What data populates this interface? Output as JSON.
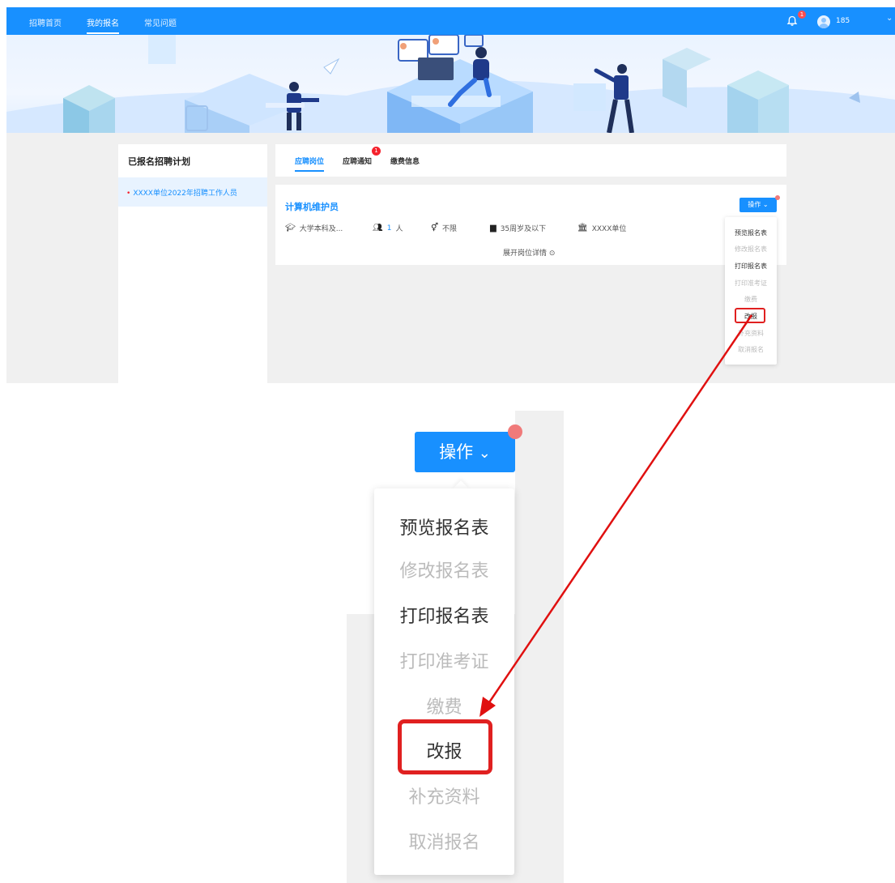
{
  "nav": {
    "items": [
      {
        "label": "招聘首页"
      },
      {
        "label": "我的报名"
      },
      {
        "label": "常见问题"
      }
    ],
    "notification_count": "1",
    "user_name": "185"
  },
  "sidebar": {
    "title": "已报名招聘计划",
    "items": [
      {
        "label": "XXXX单位2022年招聘工作人员"
      }
    ]
  },
  "tabs": [
    {
      "label": "应聘岗位"
    },
    {
      "label": "应聘通知"
    },
    {
      "label": "缴费信息"
    }
  ],
  "tab_badge": "1",
  "job": {
    "title": "计算机维护员",
    "education": "大学本科及...",
    "headcount_number": "1",
    "headcount_unit": "人",
    "gender": "不限",
    "age": "35周岁及以下",
    "employer": "XXXX单位",
    "expand_label": "展开岗位详情"
  },
  "operation_button": {
    "label": "操作"
  },
  "operation_menu": [
    {
      "label": "预览报名表",
      "enabled": true
    },
    {
      "label": "修改报名表",
      "enabled": false
    },
    {
      "label": "打印报名表",
      "enabled": true
    },
    {
      "label": "打印准考证",
      "enabled": false
    },
    {
      "label": "缴费",
      "enabled": false
    },
    {
      "label": "改报",
      "enabled": true,
      "highlighted": true
    },
    {
      "label": "补充资料",
      "enabled": false
    },
    {
      "label": "取消报名",
      "enabled": false
    }
  ],
  "colors": {
    "primary": "#1890ff",
    "badge": "#f5222d",
    "highlight_box": "#e02020",
    "arrow": "#e01010"
  }
}
